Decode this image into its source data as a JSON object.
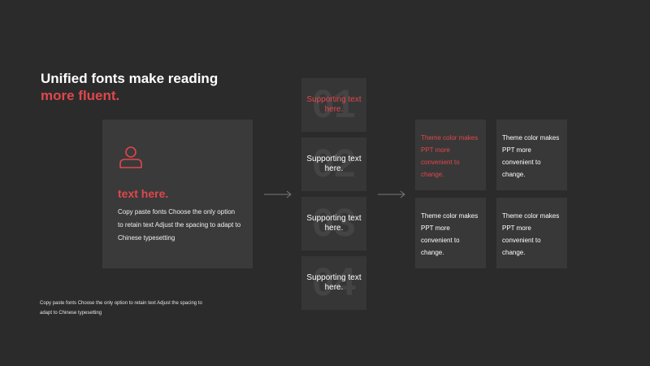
{
  "colors": {
    "background": "#2b2b2b",
    "accent": "#e0474c",
    "card": "#3a3a3a"
  },
  "title": {
    "line1": "Unified fonts make reading",
    "line2": "more fluent."
  },
  "main_card": {
    "icon": "user-icon",
    "heading": "text here.",
    "body": "Copy paste fonts Choose the only option to retain text Adjust the spacing to adapt to Chinese typesetting"
  },
  "numbered": [
    {
      "number": "01",
      "label": "Supporting text here."
    },
    {
      "number": "02",
      "label": "Supporting text here."
    },
    {
      "number": "03",
      "label": "Supporting text here."
    },
    {
      "number": "04",
      "label": "Supporting text here."
    }
  ],
  "grid": [
    {
      "text": "Theme color makes PPT more convenient to change."
    },
    {
      "text": "Theme color makes PPT more convenient to change."
    },
    {
      "text": "Theme color makes PPT more convenient to change."
    },
    {
      "text": "Theme color makes PPT more convenient to change."
    }
  ],
  "footnote": "Copy paste fonts Choose the only option to retain text Adjust the spacing to adapt to Chinese typesetting"
}
